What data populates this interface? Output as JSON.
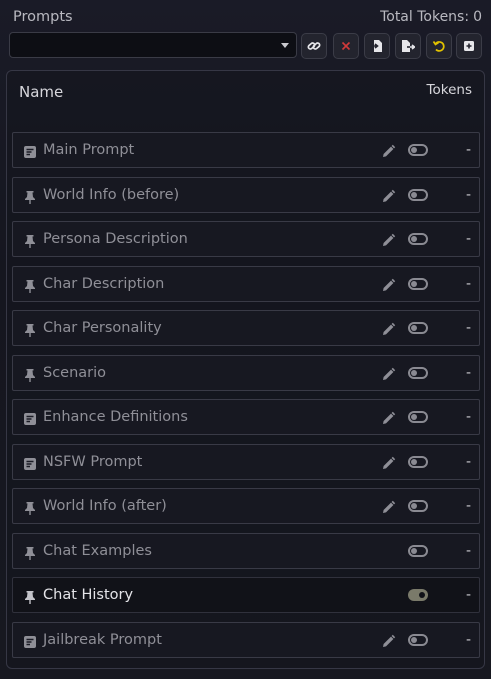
{
  "header": {
    "title": "Prompts",
    "total_label": "Total Tokens:",
    "total_value": "0"
  },
  "preset_select": {
    "value": ""
  },
  "toolbar": [
    {
      "name": "link-button",
      "icon": "link-icon",
      "color": "#e6e6ea"
    },
    {
      "name": "delete-button",
      "icon": "x-icon",
      "color": "#d23a3a"
    },
    {
      "name": "import-button",
      "icon": "file-import-icon",
      "color": "#e6e6ea"
    },
    {
      "name": "export-button",
      "icon": "file-export-icon",
      "color": "#e6e6ea"
    },
    {
      "name": "reset-button",
      "icon": "rotate-left-icon",
      "color": "#e2c200"
    },
    {
      "name": "add-prompt-button",
      "icon": "square-plus-icon",
      "color": "#e6e6ea"
    }
  ],
  "table": {
    "col_name": "Name",
    "col_tokens": "Tokens"
  },
  "prompts": [
    {
      "label": "Main Prompt",
      "icon": "list-icon",
      "editable": true,
      "enabled": false,
      "tokens": "-"
    },
    {
      "label": "World Info (before)",
      "icon": "thumbtack-icon",
      "editable": true,
      "enabled": false,
      "tokens": "-"
    },
    {
      "label": "Persona Description",
      "icon": "thumbtack-icon",
      "editable": true,
      "enabled": false,
      "tokens": "-"
    },
    {
      "label": "Char Description",
      "icon": "thumbtack-icon",
      "editable": true,
      "enabled": false,
      "tokens": "-"
    },
    {
      "label": "Char Personality",
      "icon": "thumbtack-icon",
      "editable": true,
      "enabled": false,
      "tokens": "-"
    },
    {
      "label": "Scenario",
      "icon": "thumbtack-icon",
      "editable": true,
      "enabled": false,
      "tokens": "-"
    },
    {
      "label": "Enhance Definitions",
      "icon": "list-icon",
      "editable": true,
      "enabled": false,
      "tokens": "-"
    },
    {
      "label": "NSFW Prompt",
      "icon": "list-icon",
      "editable": true,
      "enabled": false,
      "tokens": "-"
    },
    {
      "label": "World Info (after)",
      "icon": "thumbtack-icon",
      "editable": true,
      "enabled": false,
      "tokens": "-"
    },
    {
      "label": "Chat Examples",
      "icon": "thumbtack-icon",
      "editable": false,
      "enabled": false,
      "tokens": "-"
    },
    {
      "label": "Chat History",
      "icon": "thumbtack-icon",
      "editable": false,
      "enabled": true,
      "tokens": "-"
    },
    {
      "label": "Jailbreak Prompt",
      "icon": "list-icon",
      "editable": true,
      "enabled": false,
      "tokens": "-"
    }
  ]
}
